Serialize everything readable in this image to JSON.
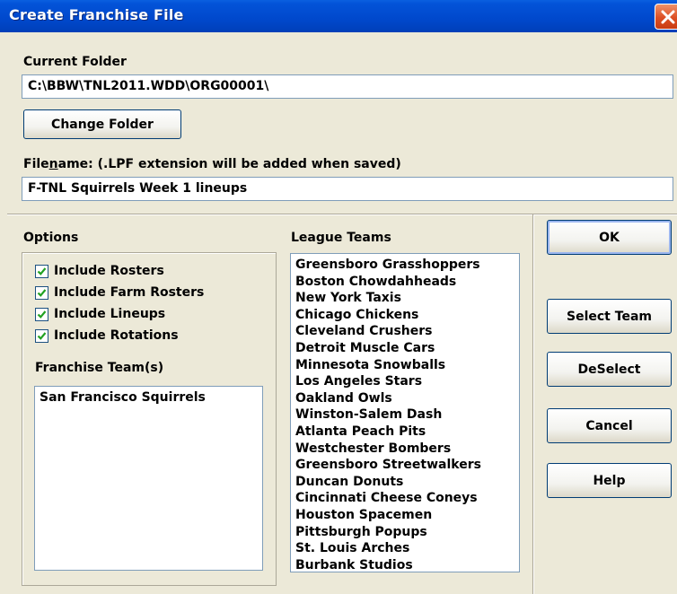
{
  "window": {
    "title": "Create Franchise File"
  },
  "current_folder": {
    "label": "Current Folder",
    "value": "C:\\BBW\\TNL2011.WDD\\ORG00001\\"
  },
  "change_folder_label": "Change Folder",
  "filename": {
    "label_prefix": "File",
    "label_mnemonic": "n",
    "label_suffix": "ame: (.LPF extension will be added when saved)",
    "value": "F-TNL Squirrels Week 1 lineups"
  },
  "options": {
    "label": "Options",
    "checkboxes": [
      {
        "label": "Include Rosters",
        "checked": true
      },
      {
        "label": "Include Farm Rosters",
        "checked": true
      },
      {
        "label": "Include Lineups",
        "checked": true
      },
      {
        "label": "Include Rotations",
        "checked": true
      }
    ]
  },
  "franchise_teams": {
    "label": "Franchise Team(s)",
    "items": [
      "San Francisco Squirrels"
    ]
  },
  "league_teams": {
    "label": "League Teams",
    "items": [
      "Greensboro Grasshoppers",
      "Boston Chowdahheads",
      "New York Taxis",
      "Chicago Chickens",
      "Cleveland Crushers",
      "Detroit Muscle Cars",
      "Minnesota Snowballs",
      "Los Angeles Stars",
      "Oakland Owls",
      "Winston-Salem Dash",
      "Atlanta Peach Pits",
      "Westchester Bombers",
      "Greensboro Streetwalkers",
      "Duncan Donuts",
      "Cincinnati Cheese Coneys",
      "Houston Spacemen",
      "Pittsburgh Popups",
      "St. Louis Arches",
      "Burbank Studios"
    ]
  },
  "buttons": {
    "ok": "OK",
    "select_team": "Select Team",
    "deselect": "DeSelect",
    "cancel": "Cancel",
    "help": "Help"
  },
  "colors": {
    "titlebar": "#0048cc",
    "dialog_bg": "#ece9d8",
    "check_green": "#21a121",
    "close_red": "#dd4f24"
  }
}
